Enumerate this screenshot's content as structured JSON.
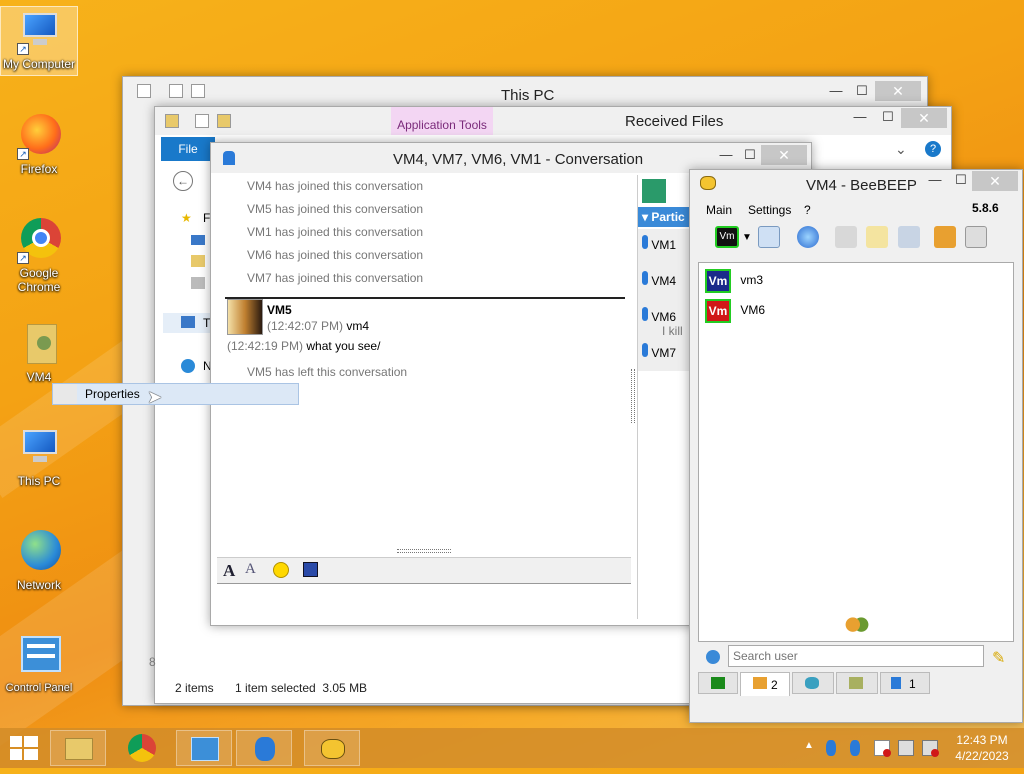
{
  "desktop": {
    "icons": [
      {
        "label": "My Computer",
        "icon": "computer-icon"
      },
      {
        "label": "Firefox",
        "icon": "firefox-icon"
      },
      {
        "label": "Google Chrome",
        "icon": "chrome-icon"
      },
      {
        "label": "VM4",
        "icon": "user-folder-icon"
      },
      {
        "label": "This PC",
        "icon": "computer-icon"
      },
      {
        "label": "Network",
        "icon": "network-globe-icon"
      },
      {
        "label": "Control Panel",
        "icon": "control-panel-icon"
      }
    ],
    "context_menu": {
      "item": "Properties"
    }
  },
  "thispc": {
    "title": "This PC",
    "status_items": "2 items",
    "status_selected": "1 item selected  3.05 MB"
  },
  "received": {
    "title": "Received Files",
    "ribbon_tab": "Application Tools",
    "file_tab": "File",
    "nav_items": [
      "Fa",
      "Th",
      "N"
    ],
    "page_num": "8"
  },
  "conversation": {
    "title": "VM4, VM7, VM6, VM1 - Conversation",
    "messages_before": [
      "VM4 has joined this conversation",
      "VM5 has joined this conversation",
      "VM1 has joined this conversation",
      "VM6 has joined this conversation",
      "VM7 has joined this conversation"
    ],
    "chat": {
      "sender": "VM5",
      "line1_time": "(12:42:07 PM)",
      "line1_text": "vm4",
      "line2_time": "(12:42:19 PM)",
      "line2_text": "what you see/"
    },
    "message_after": "VM5 has left this conversation",
    "participants_header": "Partic",
    "participants": [
      {
        "name": "VM1",
        "sub": ""
      },
      {
        "name": "VM4",
        "sub": ""
      },
      {
        "name": "VM6",
        "sub": "I kill"
      },
      {
        "name": "VM7",
        "sub": ""
      }
    ]
  },
  "beebeep": {
    "title": "VM4 - BeeBEEP",
    "menu": [
      "Main",
      "Settings",
      "?"
    ],
    "version": "5.8.6",
    "users": [
      {
        "badge": "Vm",
        "name": "vm3",
        "color": "#1a2a8a"
      },
      {
        "badge": "Vm",
        "name": "VM6",
        "color": "#d01818"
      }
    ],
    "search_placeholder": "Search user",
    "tabs": [
      {
        "label": ""
      },
      {
        "label": "2"
      },
      {
        "label": ""
      },
      {
        "label": ""
      },
      {
        "label": "1"
      }
    ]
  },
  "taskbar": {
    "time": "12:43 PM",
    "date": "4/22/2023"
  }
}
